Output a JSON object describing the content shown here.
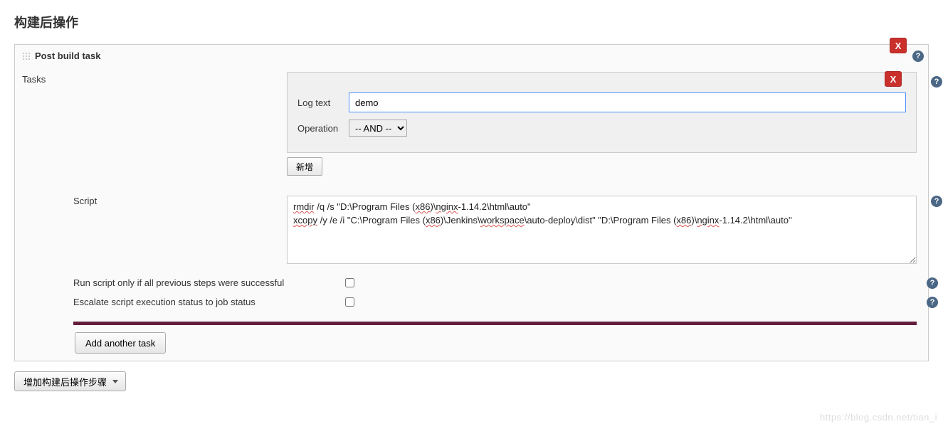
{
  "page_title": "构建后操作",
  "section": {
    "title": "Post build task",
    "close_label": "X",
    "tasks_label": "Tasks",
    "task": {
      "close_label": "X",
      "log_text_label": "Log text",
      "log_text_value": "demo",
      "operation_label": "Operation",
      "operation_value": "-- AND --",
      "add_new_label": "新增"
    },
    "script_label": "Script",
    "script_value": "rmdir /q /s \"D:\\Program Files (x86)\\nginx-1.14.2\\html\\auto\"\nxcopy /y /e /i \"C:\\Program Files (x86)\\Jenkins\\workspace\\auto-deploy\\dist\" \"D:\\Program Files (x86)\\nginx-1.14.2\\html\\auto\"",
    "script_tokens": [
      {
        "t": "rmdir",
        "w": true
      },
      {
        "t": " /q /s \"D:\\Program Files ("
      },
      {
        "t": "x86",
        "w": true
      },
      {
        "t": ")\\"
      },
      {
        "t": "nginx",
        "w": true
      },
      {
        "t": "-1.14.2\\html\\auto\"\n"
      },
      {
        "t": "xcopy",
        "w": true
      },
      {
        "t": " /y /e /i \"C:\\Program Files ("
      },
      {
        "t": "x86",
        "w": true
      },
      {
        "t": ")\\Jenkins\\"
      },
      {
        "t": "workspace",
        "w": true
      },
      {
        "t": "\\auto-deploy\\dist\" \"D:\\Program Files ("
      },
      {
        "t": "x86",
        "w": true
      },
      {
        "t": ")\\"
      },
      {
        "t": "nginx",
        "w": true
      },
      {
        "t": "-1.14.2\\html\\auto\""
      }
    ],
    "run_only_label": "Run script only if all previous steps were successful",
    "run_only_checked": false,
    "escalate_label": "Escalate script execution status to job status",
    "escalate_checked": false,
    "add_another_label": "Add another task"
  },
  "add_step_label": "增加构建后操作步骤",
  "help_glyph": "?",
  "watermark": "https://blog.csdn.net/tian_i"
}
